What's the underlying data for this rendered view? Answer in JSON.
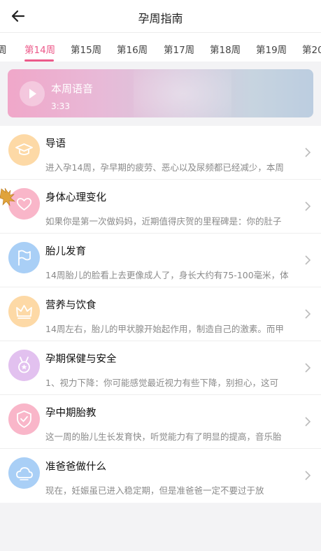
{
  "header": {
    "title": "孕周指南",
    "back_icon": "arrow-left-icon"
  },
  "tabs": [
    {
      "label": "周",
      "active": false
    },
    {
      "label": "第14周",
      "active": true
    },
    {
      "label": "第15周",
      "active": false
    },
    {
      "label": "第16周",
      "active": false
    },
    {
      "label": "第17周",
      "active": false
    },
    {
      "label": "第18周",
      "active": false
    },
    {
      "label": "第19周",
      "active": false
    },
    {
      "label": "第20",
      "active": false
    }
  ],
  "audio": {
    "title": "本周语音",
    "duration": "3:33",
    "icon": "play-icon"
  },
  "items": [
    {
      "title": "导语",
      "desc": "进入孕14周，孕早期的疲劳、恶心以及尿频都已经减少，本周",
      "icon": "graduation-cap-icon",
      "color": "#fdd9a6"
    },
    {
      "title": "身体心理变化",
      "desc": "如果你是第一次做妈妈，近期值得庆贺的里程碑是：你的肚子",
      "icon": "heart-icon",
      "color": "#f9b6c9"
    },
    {
      "title": "胎儿发育",
      "desc": "14周胎儿的脸看上去更像成人了，身长大约有75-100毫米，体",
      "icon": "flag-icon",
      "color": "#a9cff6"
    },
    {
      "title": "营养与饮食",
      "desc": "14周左右，胎儿的甲状腺开始起作用，制造自己的激素。而甲",
      "icon": "crown-icon",
      "color": "#fdd9a6"
    },
    {
      "title": "孕期保健与安全",
      "desc": "1、视力下降：你可能感觉最近视力有些下降，别担心，这可",
      "icon": "medal-icon",
      "color": "#e2c1ef"
    },
    {
      "title": "孕中期胎教",
      "desc": "这一周的胎儿生长发育快，听觉能力有了明显的提高，音乐胎",
      "icon": "shield-heart-icon",
      "color": "#f9b6c9"
    },
    {
      "title": "准爸爸做什么",
      "desc": "现在，妊娠虽已进入稳定期，但是准爸爸一定不要过于放",
      "icon": "cloud-icon",
      "color": "#a9cff6"
    }
  ],
  "colors": {
    "accent": "#ec5a8a"
  }
}
